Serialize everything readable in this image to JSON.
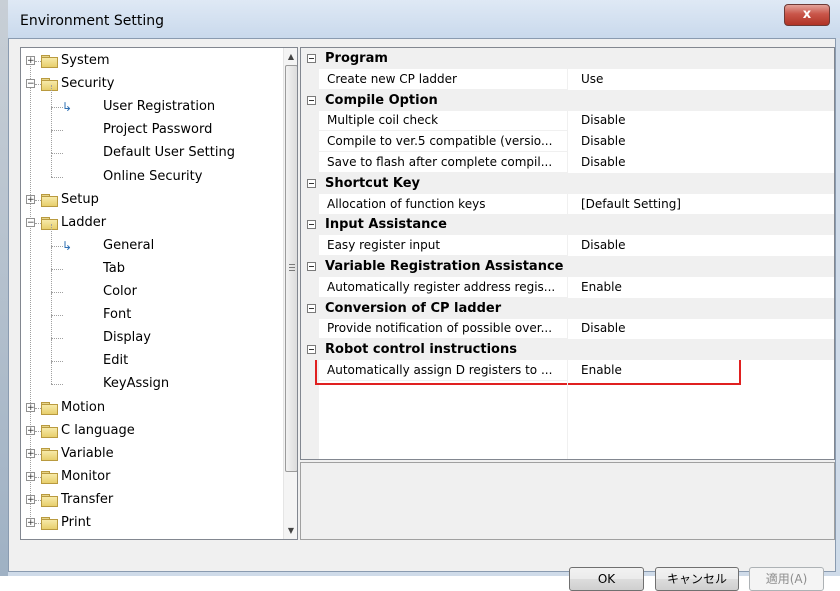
{
  "window": {
    "title": "Environment Setting",
    "close_symbol": "x"
  },
  "tree": [
    {
      "label": "System",
      "level": 0,
      "expander": "+"
    },
    {
      "label": "Security",
      "level": 0,
      "expander": "-"
    },
    {
      "label": "User Registration",
      "level": 1,
      "selected_arrow": true
    },
    {
      "label": "Project Password",
      "level": 1
    },
    {
      "label": "Default User Setting",
      "level": 1
    },
    {
      "label": "Online Security",
      "level": 1
    },
    {
      "label": "Setup",
      "level": 0,
      "expander": "+"
    },
    {
      "label": "Ladder",
      "level": 0,
      "expander": "-"
    },
    {
      "label": "General",
      "level": 1,
      "selected_arrow": true
    },
    {
      "label": "Tab",
      "level": 1
    },
    {
      "label": "Color",
      "level": 1
    },
    {
      "label": "Font",
      "level": 1
    },
    {
      "label": "Display",
      "level": 1
    },
    {
      "label": "Edit",
      "level": 1
    },
    {
      "label": "KeyAssign",
      "level": 1
    },
    {
      "label": "Motion",
      "level": 0,
      "expander": "+"
    },
    {
      "label": "C language",
      "level": 0,
      "expander": "+"
    },
    {
      "label": "Variable",
      "level": 0,
      "expander": "+"
    },
    {
      "label": "Monitor",
      "level": 0,
      "expander": "+"
    },
    {
      "label": "Transfer",
      "level": 0,
      "expander": "+"
    },
    {
      "label": "Print",
      "level": 0,
      "expander": "+"
    }
  ],
  "properties": [
    {
      "category": "Program",
      "items": [
        {
          "name": "Create new CP ladder",
          "value": "Use"
        }
      ]
    },
    {
      "category": "Compile Option",
      "items": [
        {
          "name": "Multiple coil check",
          "value": "Disable"
        },
        {
          "name": "Compile to ver.5 compatible (versio...",
          "value": "Disable"
        },
        {
          "name": "Save to flash after complete compil...",
          "value": "Disable"
        }
      ]
    },
    {
      "category": "Shortcut Key",
      "items": [
        {
          "name": "Allocation of function keys",
          "value": "[Default Setting]"
        }
      ]
    },
    {
      "category": "Input Assistance",
      "items": [
        {
          "name": "Easy register input",
          "value": "Disable"
        }
      ]
    },
    {
      "category": "Variable Registration Assistance",
      "items": [
        {
          "name": "Automatically register address regis...",
          "value": "Enable"
        }
      ]
    },
    {
      "category": "Conversion of CP ladder",
      "items": [
        {
          "name": "Provide notification of possible over...",
          "value": "Disable"
        }
      ]
    },
    {
      "category": "Robot control instructions",
      "items": [
        {
          "name": "Automatically assign D registers to ...",
          "value": "Enable"
        }
      ],
      "highlighted": true
    }
  ],
  "buttons": {
    "ok": "OK",
    "cancel": "キャンセル",
    "apply": "適用(A)"
  },
  "colors": {
    "highlight_box": "#e02020",
    "title_bg": "#dfe9f5"
  }
}
